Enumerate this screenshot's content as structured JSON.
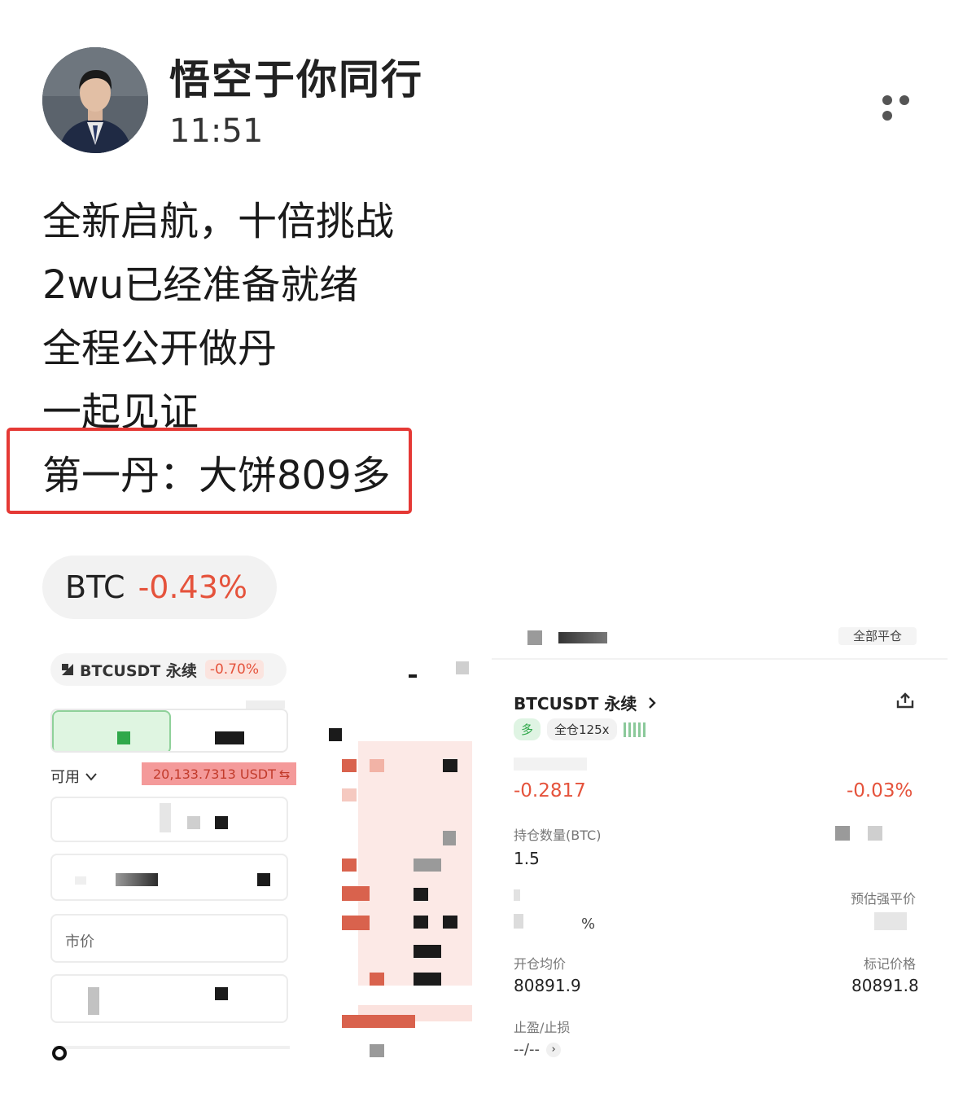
{
  "post": {
    "author": "悟空于你同行",
    "time": "11:51",
    "lines": [
      "全新启航，十倍挑战",
      "2wu已经准备就绪",
      "全程公开做丹",
      "一起见证",
      "第一丹：大饼809多"
    ]
  },
  "ticker": {
    "symbol": "BTC",
    "change": "-0.43%"
  },
  "left_screenshot": {
    "pair": "BTCUSDT 永续",
    "pair_change": "-0.70%",
    "available_label": "可用",
    "available_value": "20,133.7313 USDT",
    "order_type": "市价"
  },
  "right_screenshot": {
    "close_all": "全部平仓",
    "pair": "BTCUSDT 永续",
    "side_tag": "多",
    "margin_tag": "全仓125x",
    "pnl": "-0.2817",
    "pnl_rate": "-0.03%",
    "position_label": "持仓数量(BTC)",
    "position_value": "1.5",
    "est_liq_label": "预估强平价",
    "entry_label": "开仓均价",
    "entry_value": "80891.9",
    "mark_label": "标记价格",
    "mark_value": "80891.8",
    "tpsl_label": "止盈/止损",
    "tpsl_value": "--/--"
  },
  "colors": {
    "negative": "#e5533c",
    "highlight_border": "#e53935",
    "pill_bg": "#f2f2f2"
  },
  "icons": [
    "more-dots-icon",
    "share-icon",
    "chevron-right-icon",
    "chevron-down-icon",
    "swap-icon"
  ]
}
